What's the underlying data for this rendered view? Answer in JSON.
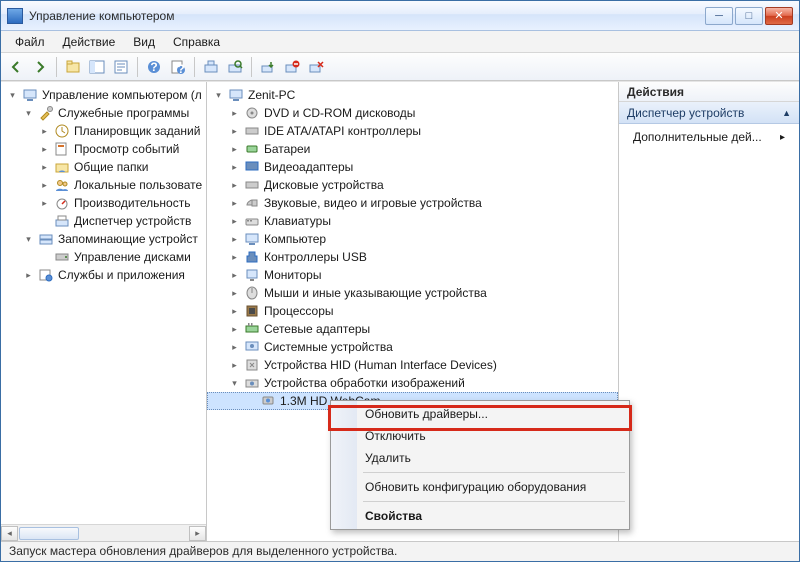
{
  "window": {
    "title": "Управление компьютером"
  },
  "menu": {
    "file": "Файл",
    "action": "Действие",
    "view": "Вид",
    "help": "Справка"
  },
  "toolbar_icons": [
    "back",
    "forward",
    "up",
    "show-hide",
    "export",
    "help1",
    "help2",
    "monitor",
    "scan",
    "computer",
    "uninstall",
    "enable"
  ],
  "left_tree": {
    "root": "Управление компьютером (л",
    "groups": [
      {
        "label": "Служебные программы",
        "expanded": true,
        "children": [
          "Планировщик заданий",
          "Просмотр событий",
          "Общие папки",
          "Локальные пользовате",
          "Производительность",
          "Диспетчер устройств"
        ]
      },
      {
        "label": "Запоминающие устройст",
        "expanded": true,
        "children": [
          "Управление дисками"
        ]
      },
      {
        "label": "Службы и приложения",
        "expanded": false,
        "children": []
      }
    ]
  },
  "center_tree": {
    "root": "Zenit-PC",
    "categories": [
      "DVD и CD-ROM дисководы",
      "IDE ATA/ATAPI контроллеры",
      "Батареи",
      "Видеоадаптеры",
      "Дисковые устройства",
      "Звуковые, видео и игровые устройства",
      "Клавиатуры",
      "Компьютер",
      "Контроллеры USB",
      "Мониторы",
      "Мыши и иные указывающие устройства",
      "Процессоры",
      "Сетевые адаптеры",
      "Системные устройства",
      "Устройства HID (Human Interface Devices)"
    ],
    "expanded_category": "Устройства обработки изображений",
    "selected_device": "1.3M HD WebCam"
  },
  "context_menu": {
    "items": [
      "Обновить драйверы...",
      "Отключить",
      "Удалить"
    ],
    "sep1": true,
    "items2": [
      "Обновить конфигурацию оборудования"
    ],
    "sep2": true,
    "items3": [
      "Свойства"
    ]
  },
  "actions": {
    "header": "Действия",
    "subheader": "Диспетчер устройств",
    "more": "Дополнительные дей..."
  },
  "statusbar": "Запуск мастера обновления драйверов для выделенного устройства."
}
